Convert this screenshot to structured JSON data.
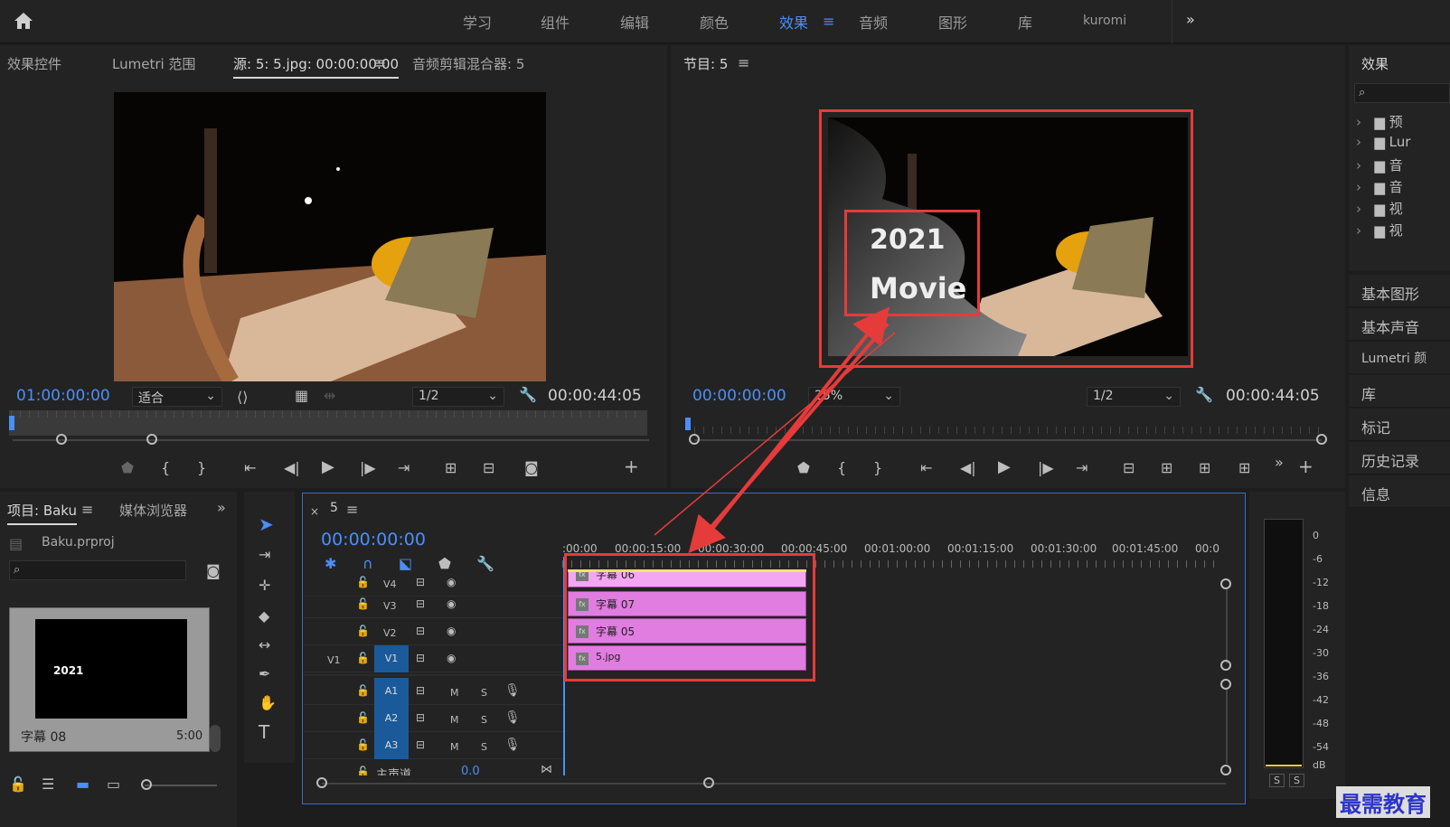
{
  "topbar": {
    "workspaces": [
      "学习",
      "组件",
      "编辑",
      "颜色",
      "效果",
      "音频",
      "图形",
      "库",
      "kuromi"
    ],
    "active_workspace": "效果",
    "more_label": "»"
  },
  "source_panel": {
    "tabs": [
      "效果控件",
      "Lumetri 范围",
      "源: 5: 5.jpg: 00:00:00:00",
      "音频剪辑混合器: 5"
    ],
    "timecode": "01:00:00:00",
    "fit_label": "适合",
    "resolution": "1/2",
    "duration": "00:00:44:05"
  },
  "program_panel": {
    "title": "节目: 5",
    "timecode": "00:00:00:00",
    "zoom": "25%",
    "resolution": "1/2",
    "duration": "00:00:44:05",
    "overlay_line1": "2021",
    "overlay_line2": "Movie"
  },
  "project_panel": {
    "tabs": [
      "项目: Baku",
      "媒体浏览器"
    ],
    "filename": "Baku.prproj",
    "item_name": "字幕 08",
    "item_duration": "5:00",
    "thumb_text": "2021"
  },
  "timeline": {
    "sequence_name": "5",
    "timecode": "00:00:00:00",
    "ruler_labels": [
      ":00:00",
      "00:00:15:00",
      "00:00:30:00",
      "00:00:45:00",
      "00:01:00:00",
      "00:01:15:00",
      "00:01:30:00",
      "00:01:45:00",
      "00:0"
    ],
    "video_tracks": [
      "V4",
      "V3",
      "V2",
      "V1"
    ],
    "source_patch": "V1",
    "audio_tracks": [
      "A1",
      "A2",
      "A3"
    ],
    "master_label": "主声道",
    "master_value": "0.0",
    "clips": [
      "字幕 06",
      "字幕 07",
      "字幕 05",
      "5.jpg"
    ],
    "mute_label": "M",
    "solo_label": "S"
  },
  "meter": {
    "scale": [
      "0",
      "-6",
      "-12",
      "-18",
      "-24",
      "-30",
      "-36",
      "-42",
      "-48",
      "-54",
      "dB"
    ],
    "solo_buttons": [
      "S",
      "S"
    ]
  },
  "effects_sidebar": {
    "title": "效果",
    "folders": [
      "预",
      "Lur",
      "音",
      "音",
      "视",
      "视"
    ],
    "links": [
      "基本图形",
      "基本声音",
      "Lumetri 颜",
      "库",
      "标记",
      "历史记录",
      "信息"
    ]
  },
  "watermark": "最需教育",
  "colors": {
    "accent": "#4a8ff7",
    "clip": "#e17de0",
    "highlight": "#e63b3b"
  }
}
